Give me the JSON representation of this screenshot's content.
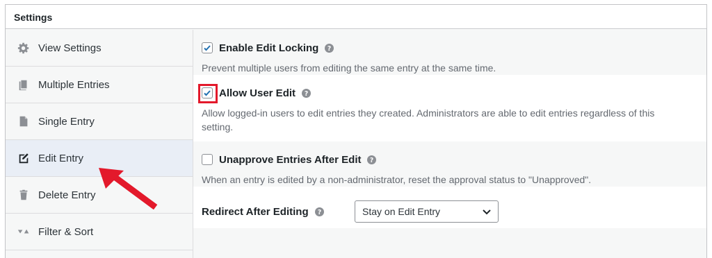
{
  "panel": {
    "title": "Settings"
  },
  "sidebar": {
    "items": [
      {
        "label": "View Settings",
        "icon": "gear-icon"
      },
      {
        "label": "Multiple Entries",
        "icon": "documents-icon"
      },
      {
        "label": "Single Entry",
        "icon": "document-icon"
      },
      {
        "label": "Edit Entry",
        "icon": "edit-page-icon",
        "active": true
      },
      {
        "label": "Delete Entry",
        "icon": "trash-icon"
      },
      {
        "label": "Filter & Sort",
        "icon": "sort-icon"
      }
    ]
  },
  "options": {
    "enable_edit_locking": {
      "label": "Enable Edit Locking",
      "checked": true,
      "description": "Prevent multiple users from editing the same entry at the same time."
    },
    "allow_user_edit": {
      "label": "Allow User Edit",
      "checked": true,
      "description": "Allow logged-in users to edit entries they created. Administrators are able to edit entries regardless of this setting."
    },
    "unapprove_after_edit": {
      "label": "Unapprove Entries After Edit",
      "checked": false,
      "description": "When an entry is edited by a non-administrator, reset the approval status to \"Unapproved\"."
    },
    "redirect_after_editing": {
      "label": "Redirect After Editing",
      "selected": "Stay on Edit Entry"
    }
  },
  "colors": {
    "accent": "#2271b1",
    "highlight_box": "#e3192b",
    "arrow": "#e3192b",
    "active_sidebar": "#e9eef6"
  }
}
